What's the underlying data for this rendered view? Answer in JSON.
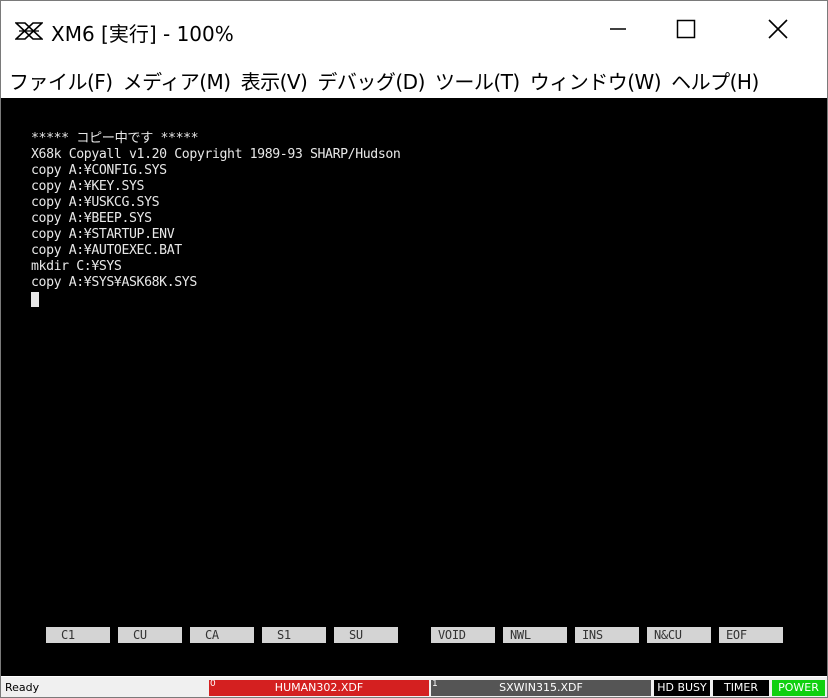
{
  "window": {
    "title": "XM6 [実行] - 100%",
    "icon": "xm6-logo-icon",
    "controls": [
      "minimize-icon",
      "maximize-icon",
      "close-icon"
    ]
  },
  "menu": [
    {
      "label": "ファイル(F)"
    },
    {
      "label": "メディア(M)"
    },
    {
      "label": "表示(V)"
    },
    {
      "label": "デバッグ(D)"
    },
    {
      "label": "ツール(T)"
    },
    {
      "label": "ウィンドウ(W)"
    },
    {
      "label": "ヘルプ(H)"
    }
  ],
  "terminal": {
    "lines": [
      "***** コピー中です *****",
      "X68k Copyall v1.20 Copyright 1989-93 SHARP/Hudson",
      "copy A:¥CONFIG.SYS",
      "copy A:¥KEY.SYS",
      "copy A:¥USKCG.SYS",
      "copy A:¥BEEP.SYS",
      "copy A:¥STARTUP.ENV",
      "copy A:¥AUTOEXEC.BAT",
      "mkdir C:¥SYS",
      "copy A:¥SYS¥ASK68K.SYS"
    ]
  },
  "function_keys": [
    "C1",
    "CU",
    "CA",
    "S1",
    "SU",
    "VOID",
    "NWL",
    "INS",
    "N&CU",
    "EOF"
  ],
  "status": {
    "ready": "Ready",
    "drive0_number": "0",
    "drive0_file": "HUMAN302.XDF",
    "drive1_number": "1",
    "drive1_file": "SXWIN315.XDF",
    "hd_busy": "HD BUSY",
    "timer": "TIMER",
    "power": "POWER"
  },
  "colors": {
    "screen_bg": "#000000",
    "text": "#e8e8e8",
    "drive0_active": "#d42020",
    "drive1": "#555555",
    "power": "#10d010"
  }
}
